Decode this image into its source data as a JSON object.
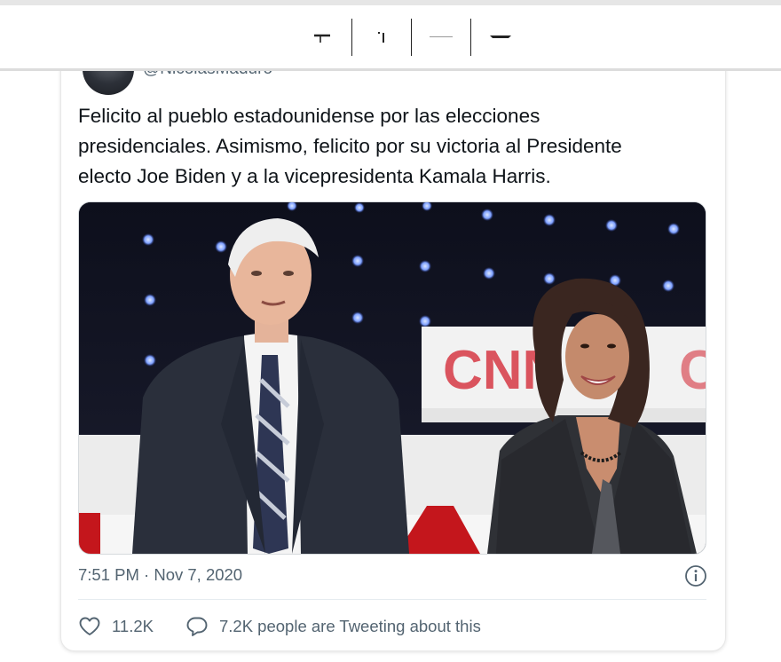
{
  "tweet": {
    "handle": "@NicolasMaduro",
    "text_lines": [
      "Felicito al pueblo estadounidense por las elecciones",
      "presidenciales. Asimismo, felicito por su victoria al Presidente",
      "electo Joe Biden y a la vicepresidenta Kamala Harris."
    ],
    "media_backdrop_text": "CNN",
    "timestamp": "7:51 PM · Nov 7, 2020",
    "likes": "11.2K",
    "tweeting_text": "7.2K people are Tweeting about this"
  },
  "icons": {
    "toolbar": [
      "tool-1-icon",
      "tool-2-icon",
      "tool-3-icon",
      "tool-4-icon"
    ],
    "info": "info-icon",
    "like": "heart-icon",
    "reply": "speech-bubble-icon"
  },
  "colors": {
    "text_primary": "#0f1419",
    "text_secondary": "#536471",
    "divider": "#e6ecf0",
    "cnn_red": "#cc0000"
  }
}
